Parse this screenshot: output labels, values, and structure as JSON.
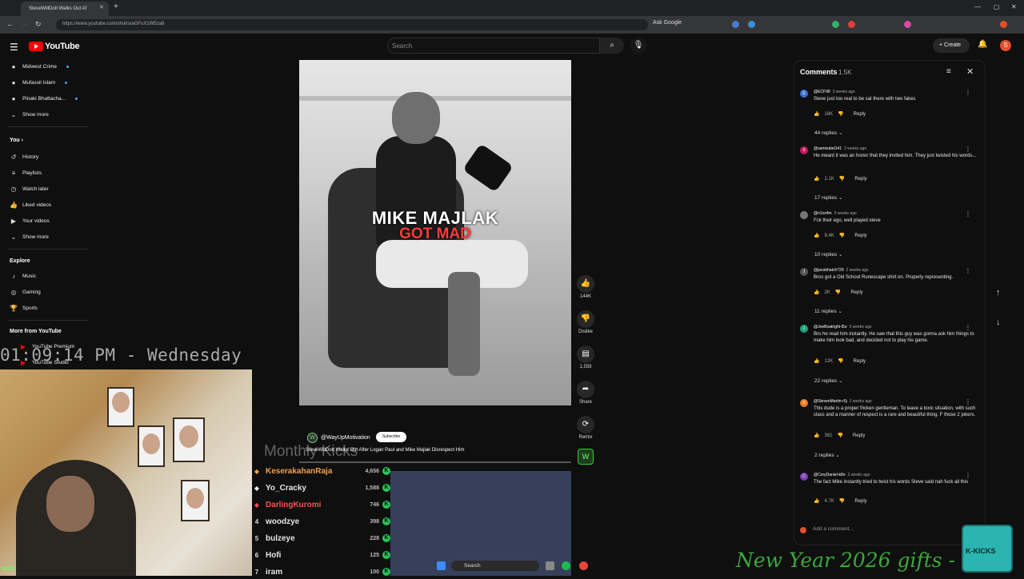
{
  "browser": {
    "tab_title": "SteveWillDoIt Walks Out Af",
    "url": "https://www.youtube.com/shorts/aGFuX1W5za8",
    "ask_google": "Ask Google"
  },
  "header": {
    "logo": "YouTube",
    "search_placeholder": "Search",
    "create": "Create",
    "avatar_letter": "S"
  },
  "sidebar": {
    "subscriptions": [
      {
        "label": "Midwest Crime"
      },
      {
        "label": "Mufassil Islam"
      },
      {
        "label": "Pinaki Bhattacha..."
      }
    ],
    "show_more_1": "Show more",
    "you_heading": "You",
    "you_items": [
      {
        "label": "History",
        "icon": "history-icon"
      },
      {
        "label": "Playlists",
        "icon": "playlists-icon"
      },
      {
        "label": "Watch later",
        "icon": "clock-icon"
      },
      {
        "label": "Liked videos",
        "icon": "thumbs-up-icon"
      },
      {
        "label": "Your videos",
        "icon": "video-icon"
      }
    ],
    "show_more_2": "Show more",
    "explore_heading": "Explore",
    "explore_items": [
      {
        "label": "Music"
      },
      {
        "label": "Gaming"
      },
      {
        "label": "Sports"
      }
    ],
    "more_heading": "More from YouTube",
    "more_items": [
      {
        "label": "YouTube Premium"
      },
      {
        "label": "YouTube Studio"
      }
    ]
  },
  "overlay": {
    "clock": "01:09:14 PM - Wednesday",
    "nick": "NICK",
    "monthly_kicks": "Monthly Kicks",
    "kicks": [
      {
        "rank": "",
        "name": "KeserakahanRaja",
        "count": "4,656",
        "color": "#f0a04b"
      },
      {
        "rank": "",
        "name": "Yo_Cracky",
        "count": "1,588",
        "color": "#e6e6e6"
      },
      {
        "rank": "",
        "name": "DarlingKuromi",
        "count": "746",
        "color": "#ff4d4d"
      },
      {
        "rank": "4",
        "name": "woodzye",
        "count": "398",
        "color": "#e6e6e6"
      },
      {
        "rank": "5",
        "name": "bulzeye",
        "count": "228",
        "color": "#e6e6e6"
      },
      {
        "rank": "6",
        "name": "Hofi",
        "count": "125",
        "color": "#e6e6e6"
      },
      {
        "rank": "7",
        "name": "iram",
        "count": "100",
        "color": "#e6e6e6"
      }
    ],
    "promo": "New Year 2026 gifts -",
    "gift_label": "K-KICKS"
  },
  "video": {
    "caption_line1": "MIKE MAJLAK",
    "caption_line2": "GOT MAD",
    "channel": "@WayUpMotivation",
    "subscribe": "Subscribe",
    "title": "SteveWillDoIt Walks Out After Logan Paul and Mike Majlak Disrespect Him",
    "likes": "144K",
    "dislike": "Dislike",
    "comments_count": "1,559",
    "share": "Share",
    "remix": "Remix"
  },
  "comments": {
    "heading": "Comments",
    "count": "1.5K",
    "items": [
      {
        "user": "@ECF98",
        "time": "3 weeks ago",
        "text": "Steve just too real to be sat there with two fakes",
        "likes": "16K",
        "replies": "44 replies",
        "avatar_color": "#3a6fd8",
        "initial": "E"
      },
      {
        "user": "@samoubel141",
        "time": "2 weeks ago",
        "text": "He meant it was an honor that they invited him. They just twisted his words...",
        "likes": "2.1K",
        "replies": "17 replies",
        "avatar_color": "#c2185b",
        "initial": "S"
      },
      {
        "user": "@n1xz4m",
        "time": "3 weeks ago",
        "text": "Fck their ego, well played steve",
        "likes": "9.4K",
        "replies": "10 replies",
        "avatar_color": "#777777",
        "initial": ""
      },
      {
        "user": "@jacobhatch729",
        "time": "2 weeks ago",
        "text": "Bros got a Old School Runescape shirt on. Properly representing.",
        "likes": "2K",
        "replies": "11 replies",
        "avatar_color": "#555555",
        "initial": "J"
      },
      {
        "user": "@JoeBoatright-l5o",
        "time": "3 weeks ago",
        "text": "Bro he read him instantly. He saw that this guy was gonna ask him things to make him look bad, and decided not to play his game.",
        "likes": "12K",
        "replies": "22 replies",
        "avatar_color": "#1fa37a",
        "initial": "J"
      },
      {
        "user": "@StevenMartin-r5j",
        "time": "2 weeks ago",
        "text": "This dude is a proper fricken gentleman. To leave a toxic situation, with such class and a manner of respect is a rare and beautiful thing. F those 2 jokers.",
        "likes": "381",
        "replies": "2 replies",
        "avatar_color": "#e67e22",
        "initial": "S"
      },
      {
        "user": "@CoryDaniel-k8o",
        "time": "3 weeks ago",
        "text": "The fact Mike instantly tried to twist his words Steve said nah fuck all this",
        "likes": "4.7K",
        "replies": "",
        "avatar_color": "#7b3fb5",
        "initial": "C"
      }
    ],
    "reply_label": "Reply",
    "add_comment": "Add a comment..."
  },
  "taskbar": {
    "search": "Search"
  }
}
